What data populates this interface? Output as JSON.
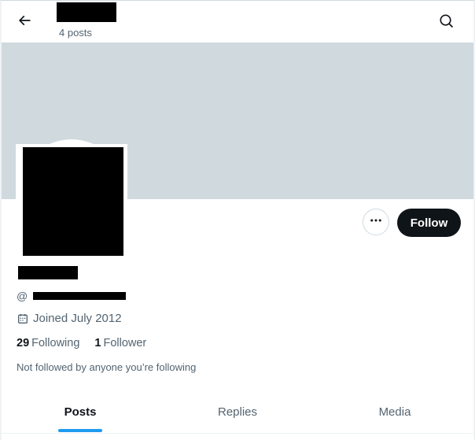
{
  "header": {
    "back_icon": "arrow-left-icon",
    "post_count": "4 posts",
    "search_icon": "search-icon"
  },
  "profile": {
    "handle_prefix": "@",
    "joined": "Joined July 2012",
    "following_count": "29",
    "following_label": "Following",
    "followers_count": "1",
    "followers_label": "Follower",
    "not_followed_text": "Not followed by anyone you’re following"
  },
  "actions": {
    "more_icon": "more-horizontal-icon",
    "follow_label": "Follow"
  },
  "tabs": [
    {
      "label": "Posts",
      "active": true
    },
    {
      "label": "Replies",
      "active": false
    },
    {
      "label": "Media",
      "active": false
    }
  ],
  "colors": {
    "banner": "#cfd9de",
    "follow_bg": "#0f1419",
    "accent": "#1d9bf0",
    "secondary_text": "#536471"
  }
}
